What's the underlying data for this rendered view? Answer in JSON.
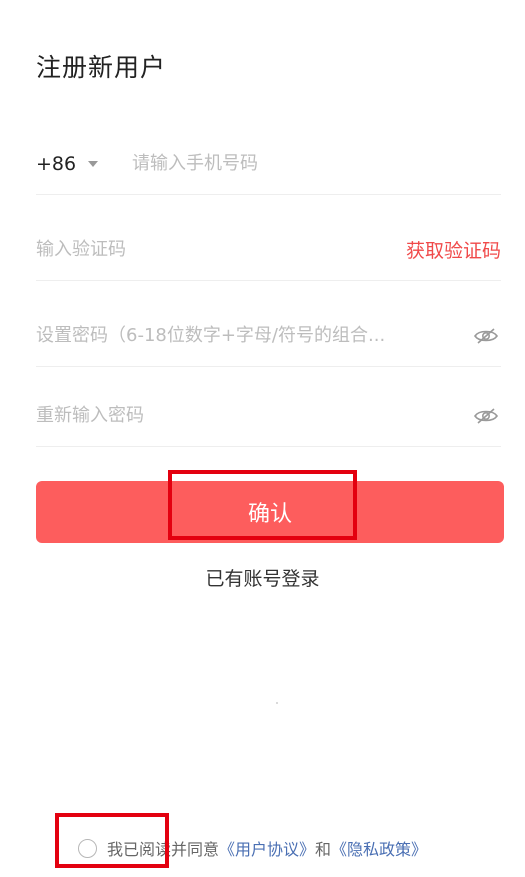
{
  "page": {
    "title": "注册新用户"
  },
  "form": {
    "country_code": "+86",
    "phone_placeholder": "请输入手机号码",
    "code_placeholder": "输入验证码",
    "get_code_label": "获取验证码",
    "password_placeholder": "设置密码（6-18位数字+字母/符号的组合...",
    "repassword_placeholder": "重新输入密码"
  },
  "actions": {
    "confirm_label": "确认",
    "login_link_label": "已有账号登录"
  },
  "agreement": {
    "prefix": "我已阅读并同意",
    "user_agreement": "《用户协议》",
    "and": "和",
    "privacy_policy": "《隐私政策》"
  },
  "colors": {
    "primary_button": "#fd5d5d",
    "accent_text": "#f04a4a",
    "link": "#4a6fb3",
    "highlight_box": "#e3000f"
  },
  "icons": {
    "caret": "chevron-down-icon",
    "eye": "eye-off-icon",
    "radio": "radio-unchecked-icon"
  }
}
